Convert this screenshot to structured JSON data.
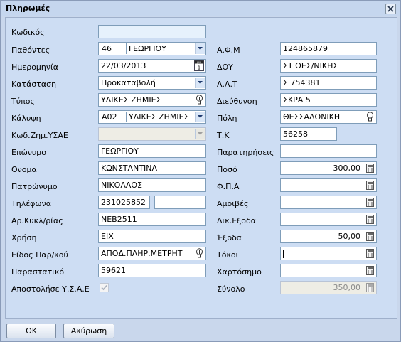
{
  "window": {
    "title": "Πληρωμές"
  },
  "left": {
    "code": {
      "label": "Κωδικός",
      "value": ""
    },
    "payee": {
      "label": "Παθόντες",
      "code": "46",
      "name": "ΓΕΩΡΓΙΟΥ"
    },
    "date": {
      "label": "Ημερομηνία",
      "value": "22/03/2013"
    },
    "status": {
      "label": "Κατάσταση",
      "value": "Προκαταβολή"
    },
    "type": {
      "label": "Τύπος",
      "value": "ΥΛΙΚΕΣ ΖΗΜΙΕΣ"
    },
    "coverage": {
      "label": "Κάλυψη",
      "code": "A02",
      "name": "ΥΛΙΚΕΣ ΖΗΜΙΕΣ"
    },
    "damage_code": {
      "label": "Κωδ.Ζημ.ΥΣΑΕ",
      "value": ""
    },
    "surname": {
      "label": "Επώνυμο",
      "value": "ΓΕΩΡΓΙΟΥ"
    },
    "first_name": {
      "label": "Ονομα",
      "value": "ΚΩΝΣΤΑΝΤΙΝΑ"
    },
    "father_name": {
      "label": "Πατρώνυμο",
      "value": "ΝΙΚΟΛΑΟΣ"
    },
    "phone": {
      "label": "Τηλέφωνα",
      "value1": "231025852",
      "value2": ""
    },
    "plate": {
      "label": "Αρ.Κυκλ/ρίας",
      "value": "ΝΕΒ2511"
    },
    "usage": {
      "label": "Χρήση",
      "value": "ΕΙΧ"
    },
    "payment_kind": {
      "label": "Είδος Παρ/κού",
      "value": "ΑΠΟΔ.ΠΛΗΡ.ΜΕΤΡΗΤ"
    },
    "voucher": {
      "label": "Παραστατικό",
      "value": "59621"
    },
    "send": {
      "label": "Αποστολήσε Υ.Σ.Α.Ε",
      "checked": true
    }
  },
  "right": {
    "afm": {
      "label": "Α.Φ.Μ",
      "value": "124865879"
    },
    "doy": {
      "label": "ΔΟΥ",
      "value": "ΣΤ ΘΕΣ/ΝΙΚΗΣ"
    },
    "aat": {
      "label": "Α.Α.Τ",
      "value": "Σ 754381"
    },
    "address": {
      "label": "Διεύθυνση",
      "value": "ΣΚΡΑ 5"
    },
    "city": {
      "label": "Πόλη",
      "value": "ΘΕΣΣΑΛΟΝΙΚΗ"
    },
    "zip": {
      "label": "Τ.Κ",
      "value": "56258"
    },
    "remarks": {
      "label": "Παρατηρήσεις",
      "value": ""
    },
    "amount": {
      "label": "Ποσό",
      "value": "300,00"
    },
    "vat": {
      "label": "Φ.Π.Α",
      "value": ""
    },
    "fees": {
      "label": "Αμοιβές",
      "value": ""
    },
    "court": {
      "label": "Δικ.Εξοδα",
      "value": ""
    },
    "expenses": {
      "label": "Έξοδα",
      "value": "50,00"
    },
    "interest": {
      "label": "Τόκοι",
      "value": ""
    },
    "stamp": {
      "label": "Χαρτόσημο",
      "value": ""
    },
    "total": {
      "label": "Σύνολο",
      "value": "350,00"
    }
  },
  "buttons": {
    "ok": "ΟΚ",
    "cancel": "Ακύρωση"
  },
  "colors": {
    "window_bg": "#c9d7ec",
    "panel_bg": "#cdddf3",
    "field_border": "#7f9db9",
    "focused_field": "#e6f1fc"
  }
}
